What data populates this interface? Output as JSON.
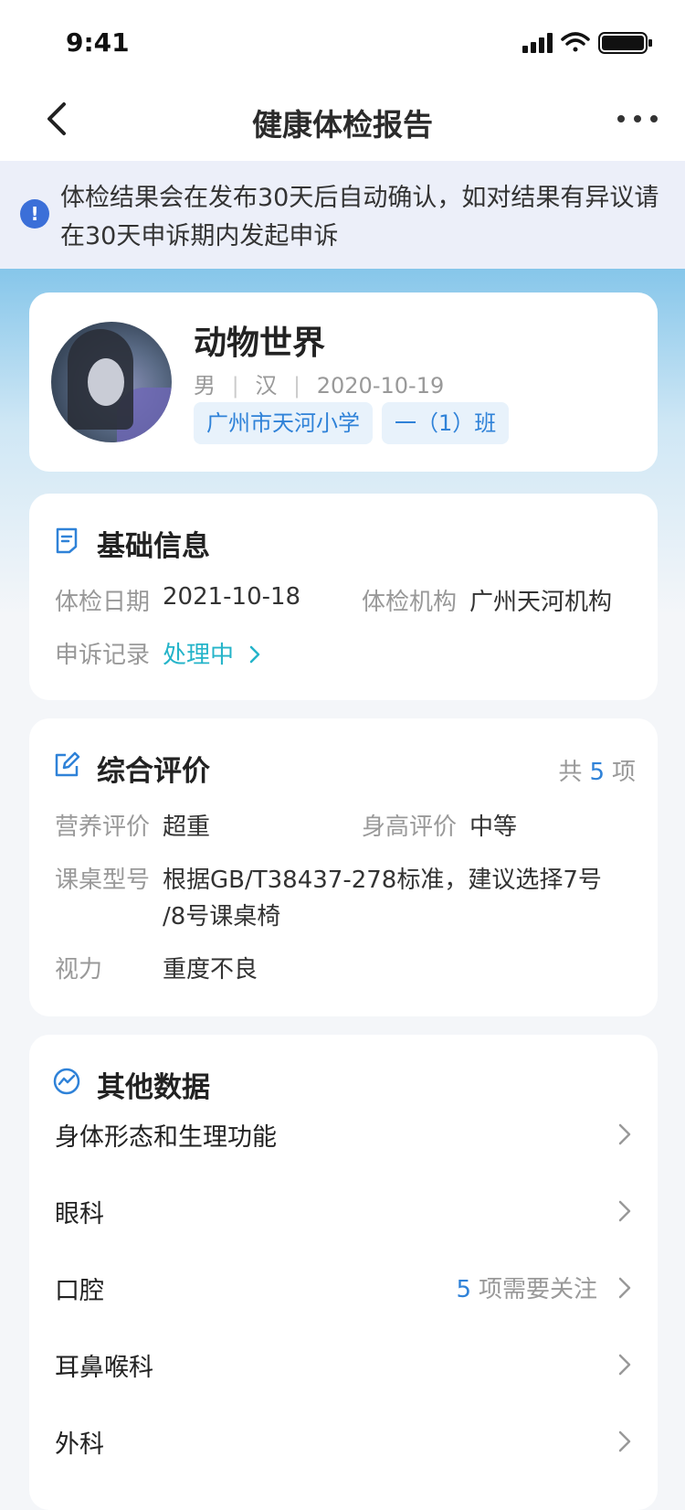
{
  "status_bar": {
    "time": "9:41"
  },
  "nav": {
    "title": "健康体检报告"
  },
  "notice": {
    "text": "体检结果会在发布30天后自动确认，如对结果有异议请在30天申诉期内发起申诉"
  },
  "profile": {
    "name": "动物世界",
    "gender": "男",
    "ethnicity": "汉",
    "birth_date": "2020-10-19",
    "school": "广州市天河小学",
    "class": "一（1）班"
  },
  "basic_info": {
    "title": "基础信息",
    "exam_date_label": "体检日期",
    "exam_date": "2021-10-18",
    "org_label": "体检机构",
    "org": "广州天河机构",
    "appeal_label": "申诉记录",
    "appeal_status": "处理中"
  },
  "evaluation": {
    "title": "综合评价",
    "count_prefix": "共",
    "count": "5",
    "count_suffix": "项",
    "nutrition_label": "营养评价",
    "nutrition_value": "超重",
    "height_label": "身高评价",
    "height_value": "中等",
    "desk_label": "课桌型号",
    "desk_value_line1": "根据GB/T38437-278标准，建议选择7号",
    "desk_value_line2": "/8号课桌椅",
    "vision_label": "视力",
    "vision_value": "重度不良"
  },
  "other_data": {
    "title": "其他数据",
    "items": [
      {
        "label": "身体形态和生理功能"
      },
      {
        "label": "眼科"
      },
      {
        "label": "口腔",
        "note_count": "5",
        "note_text": "项需要关注"
      },
      {
        "label": "耳鼻喉科"
      },
      {
        "label": "外科"
      }
    ]
  },
  "colors": {
    "accent": "#2f82d8",
    "teal": "#25b4c9"
  }
}
